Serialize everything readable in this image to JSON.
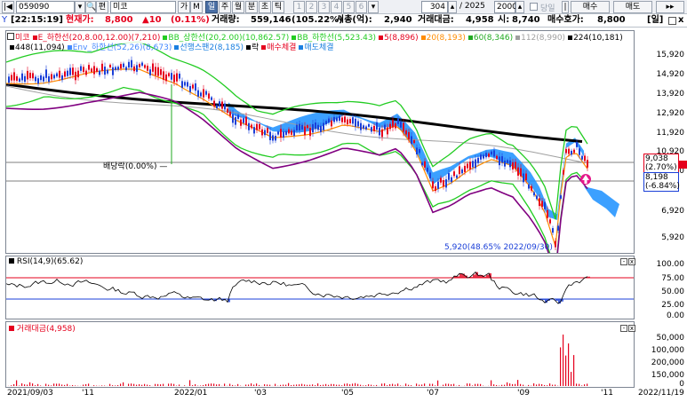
{
  "toolbar": {
    "code": "059090",
    "search_icon": "search-icon",
    "tag": "편",
    "name": "미코",
    "btn_ga": "가",
    "btn_m": "M",
    "periods": [
      "일",
      "주",
      "월",
      "분",
      "초",
      "틱"
    ],
    "period_active": "일",
    "nums": [
      "1",
      "2",
      "3",
      "4",
      "5",
      "6"
    ],
    "count": "304",
    "total": "/ 2025",
    "view": "2000",
    "chk_label": "당일",
    "buy": "매수",
    "sell": "매도"
  },
  "quote": {
    "time": "[22:15:19]",
    "price_label": "현재가:",
    "price": "8,800",
    "change": "▲10",
    "pct": "(0.11%)",
    "vol_label": "거래량:",
    "vol": "559,146",
    "vol_pct": "(105.22%)",
    "cap_label": "시총(억):",
    "cap": "2,940",
    "amt_label": "거래대금:",
    "amt": "4,958",
    "open_label": "시:",
    "open": "8,740",
    "bid_label": "매수호가:",
    "bid": "8,800",
    "unit": "[일]",
    "colors": {
      "up": "#e5001d",
      "down": "#1a3fd8"
    }
  },
  "main": {
    "legend1": [
      {
        "text": "미코",
        "color": "#e5001d"
      },
      {
        "text": "E_하한선(20,8.00,12.00)(7,210)",
        "color": "#e5001d"
      },
      {
        "text": "BB_상한선(20,2.00)(10,862.57)",
        "color": "#22cc22"
      },
      {
        "text": "BB_하한선(5,523.43)",
        "color": "#22cc22"
      },
      {
        "text": "5(8,896)",
        "color": "#e5001d"
      },
      {
        "text": "20(8,193)",
        "color": "#ff8c00"
      },
      {
        "text": "60(8,346)",
        "color": "#22aa22"
      },
      {
        "text": "112(8,990)",
        "color": "#a0a0a0"
      },
      {
        "text": "224(10,181)",
        "color": "#000000"
      }
    ],
    "legend2": [
      {
        "text": "448(11,094)",
        "color": "#000000"
      },
      {
        "text": "Env_하한선(52,26)(8,673)",
        "color": "#4488ff"
      },
      {
        "text": "선행스팬2(8,185)",
        "color": "#1a7fe0"
      },
      {
        "text": "락",
        "color": "#000000"
      },
      {
        "text": "매수체결",
        "color": "#e5001d"
      },
      {
        "text": "매도체결",
        "color": "#1a7fe0"
      }
    ],
    "yticks": [
      "15,920",
      "14,920",
      "13,920",
      "12,920",
      "11,920",
      "10,920",
      "9,920",
      "6,920",
      "5,920"
    ],
    "box1_price": "9,038",
    "box1_pct": "(2.70%)",
    "box2_price": "8,198",
    "box2_pct": "(-6.84%)",
    "annot_div": "배당락(0.00%)",
    "annot_low": "5,920(48.65% 2022/09/30)",
    "series": {
      "candles_color": "#e5001d",
      "bb_color": "#22cc22",
      "ma20_color": "#ff8c00",
      "ma224_color": "#000000",
      "ichimoku_color": "#1a8fff",
      "lower_env_color": "#800080"
    }
  },
  "rsi": {
    "label": "RSI(14,9)(65.62)",
    "yticks": [
      "100.00",
      "75.00",
      "50.00",
      "25.00",
      "0.00"
    ],
    "upper": 70,
    "lower": 30,
    "colors": {
      "line": "#000000",
      "upper": "#e5001d",
      "lower": "#1a3fd8"
    }
  },
  "volume": {
    "label": "거래대금(4,958)",
    "yticks": [
      "200,000",
      "150,000",
      "100,000",
      "50,000",
      "0"
    ],
    "color": "#e5001d"
  },
  "xaxis": [
    "2021/09/03",
    "'11",
    "2022/01",
    "'03",
    "'05",
    "'07",
    "'09",
    "'11",
    "2022/11/19"
  ]
}
